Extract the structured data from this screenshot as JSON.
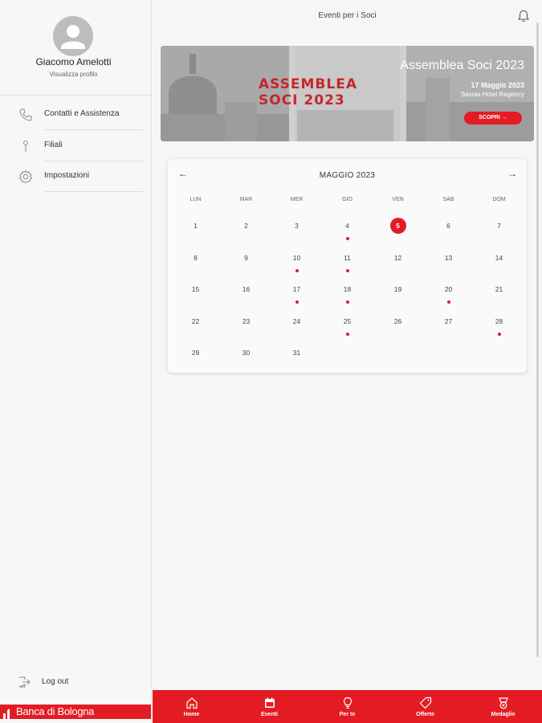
{
  "sidebar": {
    "user_name": "Giacomo Amelotti",
    "view_profile": "Visualizza profilo",
    "menu": [
      {
        "label": "Contatti e Assistenza",
        "icon": "phone-icon"
      },
      {
        "label": "Filiali",
        "icon": "location-pin-icon"
      },
      {
        "label": "Impostazioni",
        "icon": "gear-icon"
      }
    ],
    "logout": "Log out",
    "brand": "Banca di Bologna"
  },
  "header": {
    "title": "Eventi per i Soci",
    "notification_icon": "bell-icon"
  },
  "banner": {
    "headline_line1": "ASSEMBLEA",
    "headline_line2": "SOCI 2023",
    "title": "Assemblea Soci 2023",
    "date": "17 Maggio 2023",
    "venue": "Savoia Hotel Regency",
    "cta": "SCOPRI →"
  },
  "calendar": {
    "month_label": "MAGGIO 2023",
    "prev": "←",
    "next": "→",
    "weekdays": [
      "LUN",
      "MAR",
      "MER",
      "GIO",
      "VEN",
      "SAB",
      "DOM"
    ],
    "selected_day": 5,
    "event_days": [
      4,
      10,
      11,
      17,
      18,
      20,
      25,
      28
    ],
    "days": [
      "1",
      "2",
      "3",
      "4",
      "5",
      "6",
      "7",
      "8",
      "9",
      "10",
      "11",
      "12",
      "13",
      "14",
      "15",
      "16",
      "17",
      "18",
      "19",
      "20",
      "21",
      "22",
      "23",
      "24",
      "25",
      "26",
      "27",
      "28",
      "29",
      "30",
      "31"
    ]
  },
  "bottom_nav": [
    {
      "label": "Home",
      "icon": "home-icon"
    },
    {
      "label": "Eventi",
      "icon": "calendar-icon"
    },
    {
      "label": "Per te",
      "icon": "lightbulb-icon"
    },
    {
      "label": "Offerte",
      "icon": "tag-icon"
    },
    {
      "label": "Medaglie",
      "icon": "medal-icon"
    }
  ],
  "colors": {
    "accent": "#e31c24",
    "sidebar_bg": "#f7f7f7",
    "main_bg": "#f6f6f6"
  }
}
